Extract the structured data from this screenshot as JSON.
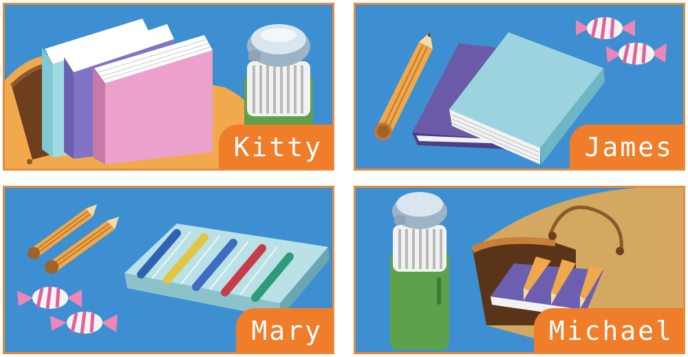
{
  "panels": [
    {
      "name": "Kitty",
      "items": [
        "backpack",
        "books",
        "water-bottle"
      ]
    },
    {
      "name": "James",
      "items": [
        "pencil",
        "books",
        "candies"
      ]
    },
    {
      "name": "Mary",
      "items": [
        "pencils",
        "crayon-box",
        "candies"
      ]
    },
    {
      "name": "Michael",
      "items": [
        "water-bottle",
        "bag",
        "book",
        "pencils"
      ]
    }
  ],
  "colors": {
    "panel_background": "#3d8fd2",
    "panel_border": "#e98a3a",
    "name_tag": "#ef7d2a",
    "name_text": "#ffffff"
  }
}
